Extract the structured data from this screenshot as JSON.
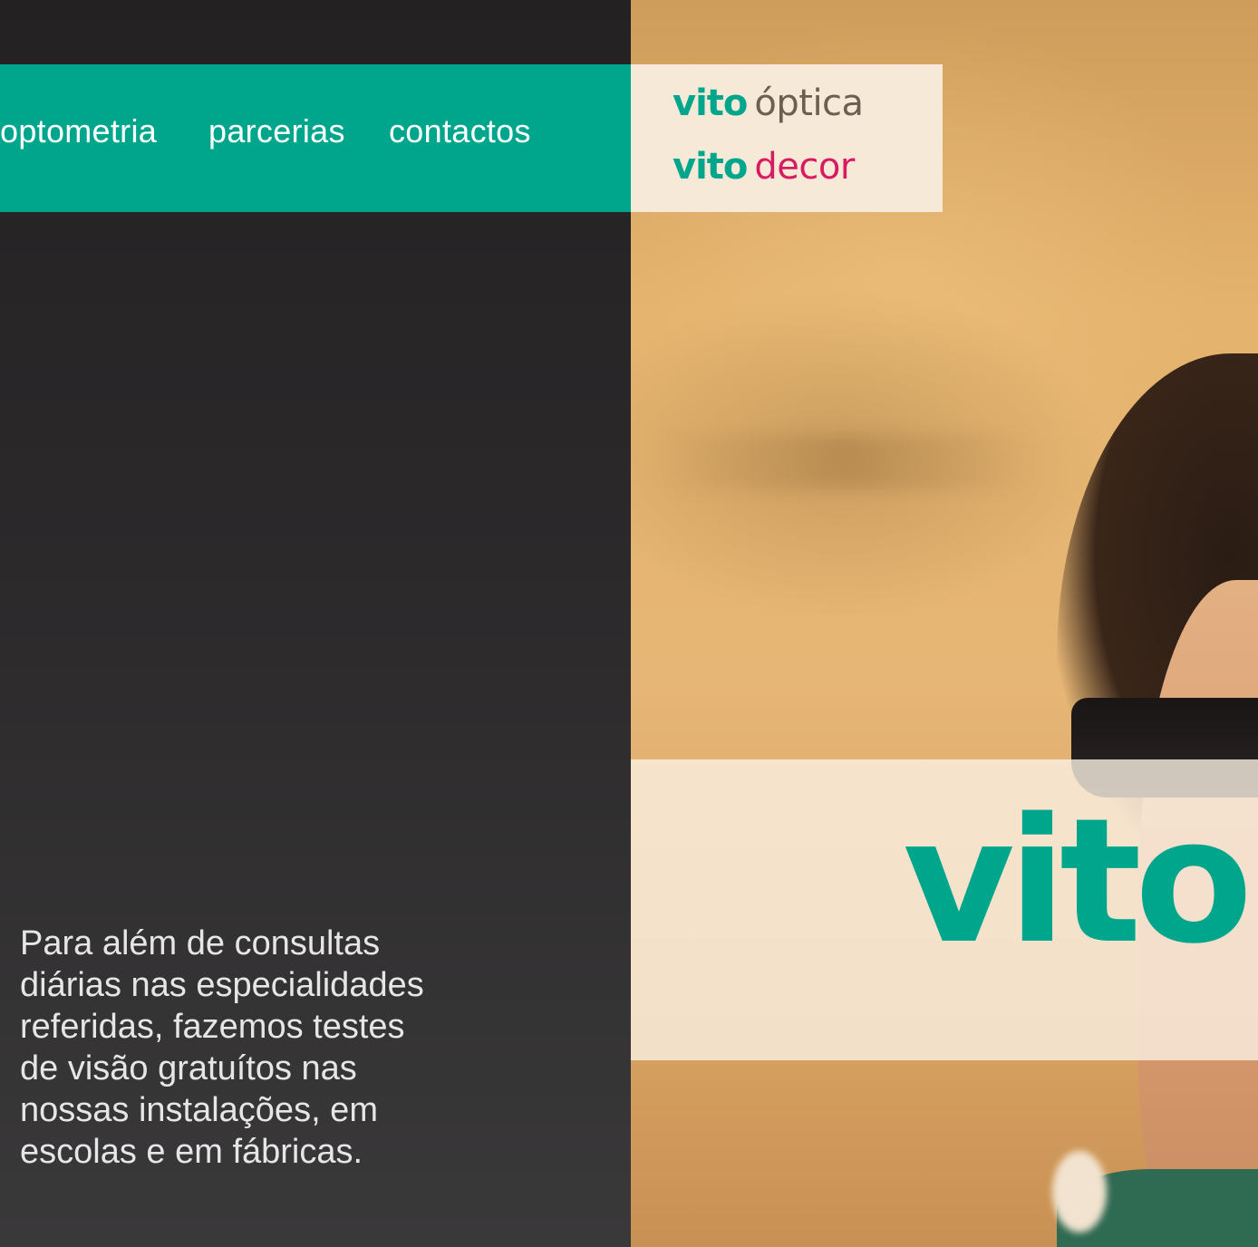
{
  "nav": {
    "items": [
      {
        "label": "optometria"
      },
      {
        "label": "parcerias"
      },
      {
        "label": "contactos"
      }
    ]
  },
  "brands": {
    "optica": {
      "mark": "vito",
      "word": "óptica"
    },
    "decor": {
      "mark": "vito",
      "word": "decor"
    }
  },
  "hero": {
    "logo": "vito"
  },
  "intro": {
    "lines": [
      "Para além de consultas",
      "diárias nas especialidades",
      "referidas, fazemos testes",
      "de visão gratuítos nas",
      "nossas instalações, em",
      "escolas e em fábricas."
    ]
  },
  "colors": {
    "accent": "#00a68c",
    "dark_panel": "#2b292a",
    "decor_pink": "#d81b60",
    "optica_brown": "#6e5e50",
    "cream": "#f6e9d8"
  }
}
